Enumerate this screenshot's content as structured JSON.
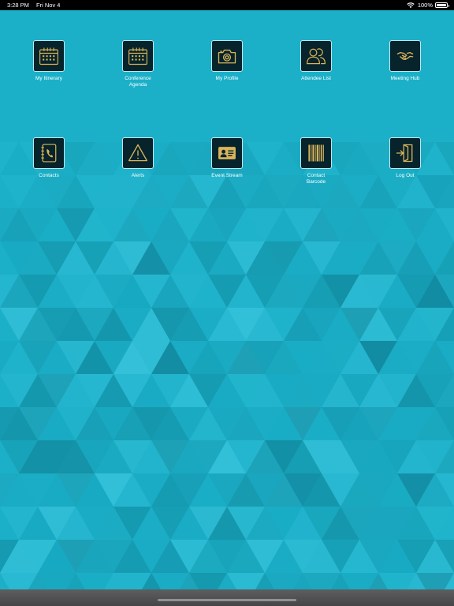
{
  "status_bar": {
    "time": "3:28 PM",
    "date": "Fri Nov 4",
    "battery": "100%"
  },
  "theme": {
    "accent": "#d9b45a",
    "tile_bg": "#07232b",
    "tile_border": "#bfe7ee"
  },
  "tiles": [
    {
      "label": "My Itinerary",
      "icon": "calendar-icon"
    },
    {
      "label": "Conference\nAgenda",
      "icon": "calendar-icon"
    },
    {
      "label": "My Profile",
      "icon": "camera-icon"
    },
    {
      "label": "Attendee List",
      "icon": "people-icon"
    },
    {
      "label": "Meeting Hub",
      "icon": "handshake-icon"
    },
    {
      "label": "Contacts",
      "icon": "address-book-icon"
    },
    {
      "label": "Alerts",
      "icon": "warning-icon"
    },
    {
      "label": "Event Stream",
      "icon": "id-card-icon"
    },
    {
      "label": "Contact\nBarcode",
      "icon": "barcode-icon"
    },
    {
      "label": "Log Out",
      "icon": "logout-icon"
    }
  ]
}
